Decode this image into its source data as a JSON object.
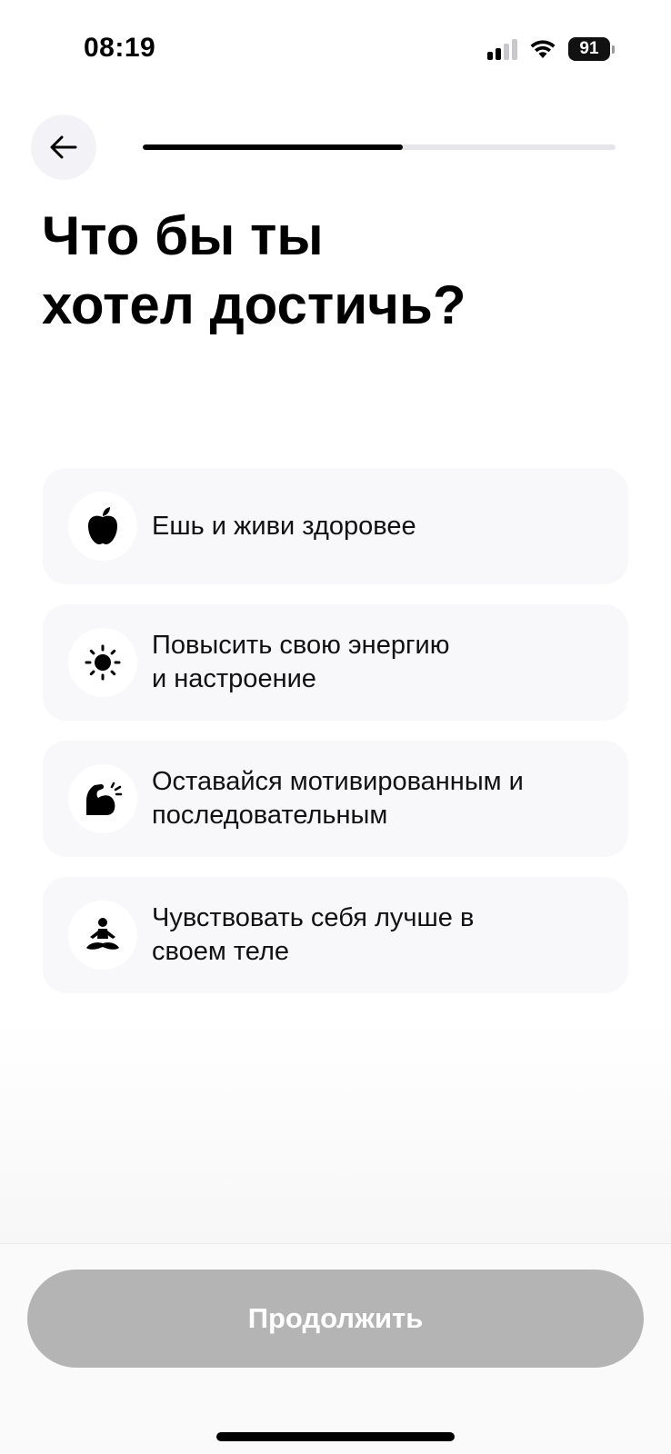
{
  "status_bar": {
    "time": "08:19",
    "battery": "91",
    "icons": [
      "cellular-signal-icon",
      "wifi-icon",
      "battery-icon"
    ]
  },
  "header": {
    "back_icon": "arrow-left-icon",
    "progress": 0.55
  },
  "title": {
    "line1": "Что бы ты",
    "line2": "хотел достичь?"
  },
  "options": [
    {
      "icon": "apple-icon",
      "label": "Ешь и живи здоровее"
    },
    {
      "icon": "sun-icon",
      "label": "Повысить свою энергию\nи настроение"
    },
    {
      "icon": "flexed-biceps-icon",
      "label": "Оставайся мотивированным и\nпоследовательным"
    },
    {
      "icon": "meditation-icon",
      "label": "Чувствовать себя лучше в\nсвоем теле"
    }
  ],
  "continue_button": {
    "label": "Продолжить",
    "state": "disabled"
  },
  "colors": {
    "accent": "#000000",
    "option_bg": "#f8f8fb",
    "button_disabled": "#b4b4b4",
    "progress_track": "#e6e6ea"
  }
}
